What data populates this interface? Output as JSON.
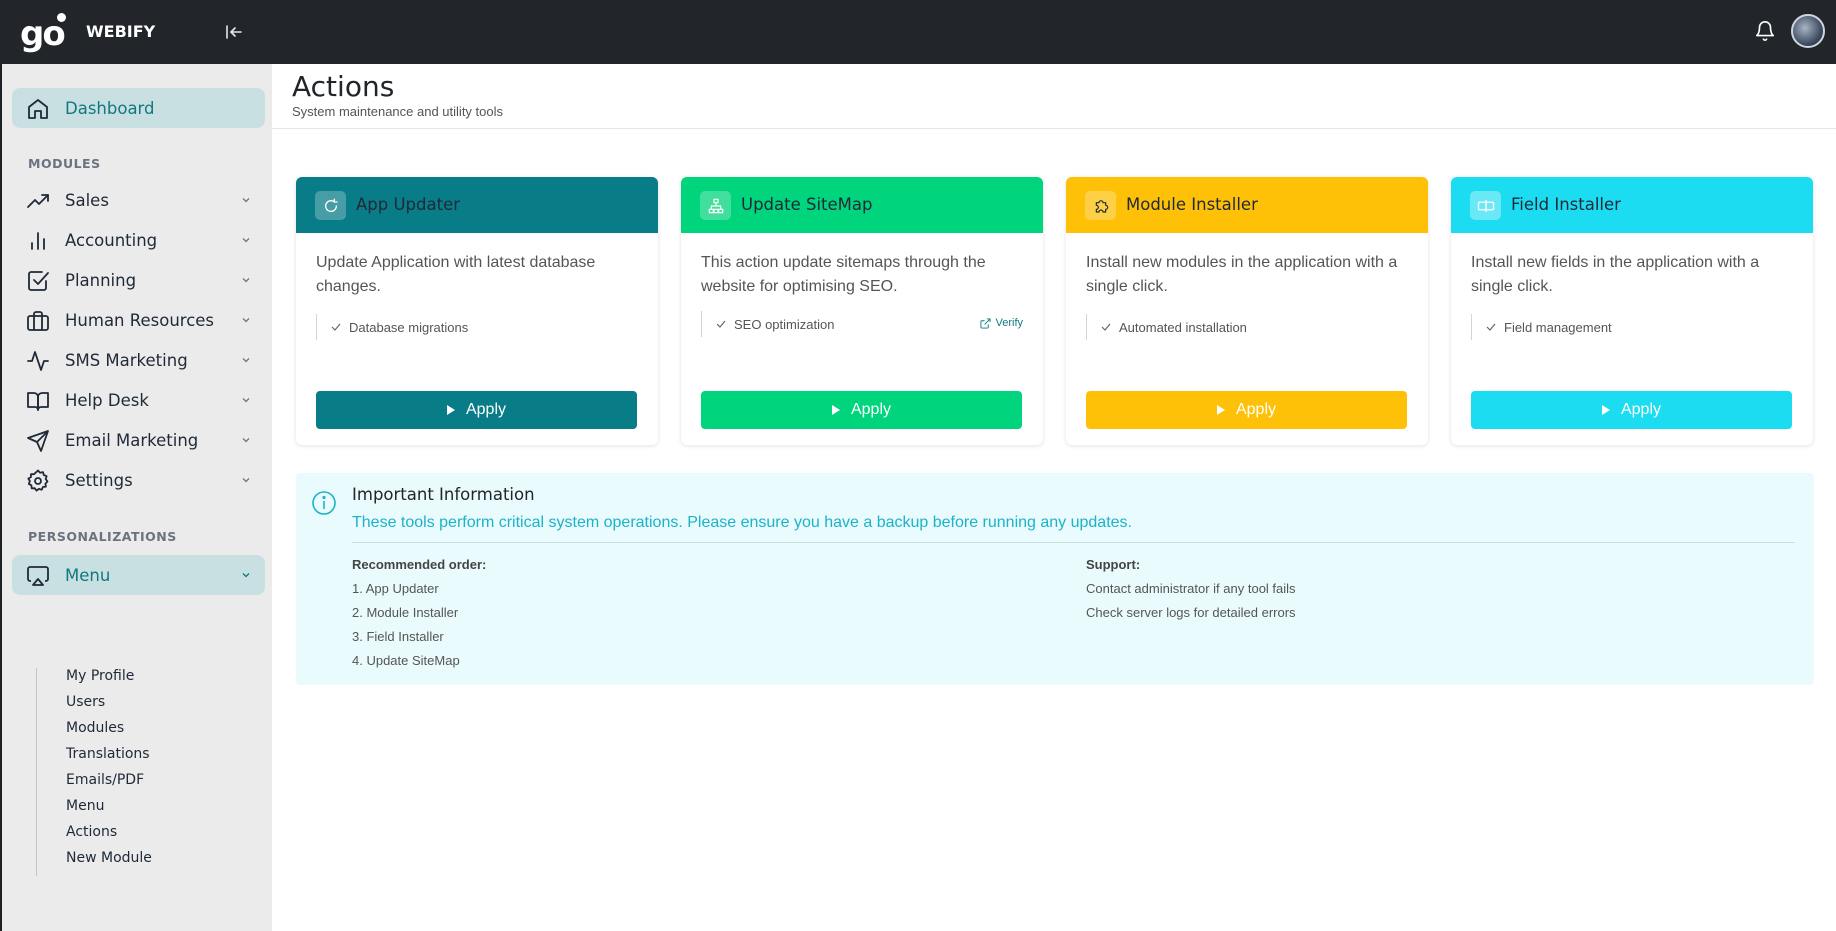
{
  "app": {
    "logo": "go",
    "brand": "WEBIFY"
  },
  "sidebar": {
    "dashboard": "Dashboard",
    "modules_title": "MODULES",
    "modules": [
      {
        "label": "Sales",
        "icon": "trending-up-icon"
      },
      {
        "label": "Accounting",
        "icon": "bar-chart-icon"
      },
      {
        "label": "Planning",
        "icon": "checkbox-icon"
      },
      {
        "label": "Human Resources",
        "icon": "briefcase-icon"
      },
      {
        "label": "SMS Marketing",
        "icon": "activity-icon"
      },
      {
        "label": "Help Desk",
        "icon": "book-icon"
      },
      {
        "label": "Email Marketing",
        "icon": "send-icon"
      },
      {
        "label": "Settings",
        "icon": "gear-icon"
      }
    ],
    "personalizations_title": "PERSONALIZATIONS",
    "menu_label": "Menu",
    "submenu": [
      "My Profile",
      "Users",
      "Modules",
      "Translations",
      "Emails/PDF",
      "Menu",
      "Actions",
      "New Module"
    ]
  },
  "page": {
    "title": "Actions",
    "subtitle": "System maintenance and utility tools"
  },
  "cards": [
    {
      "title": "App Updater",
      "icon": "refresh-icon",
      "description": "Update Application with latest database changes.",
      "feature": "Database migrations",
      "button": "Apply",
      "color": "#087c87",
      "text_color": "#ffffff"
    },
    {
      "title": "Update SiteMap",
      "icon": "sitemap-icon",
      "description": "This action update sitemaps through the website for optimising SEO.",
      "feature": "SEO optimization",
      "link": "Verify",
      "button": "Apply",
      "color": "#00d47d",
      "text_color": "#ffffff"
    },
    {
      "title": "Module Installer",
      "icon": "puzzle-icon",
      "description": "Install new modules in the application with a single click.",
      "feature": "Automated installation",
      "button": "Apply",
      "color": "#fec107",
      "text_color": "#ffffff"
    },
    {
      "title": "Field Installer",
      "icon": "input-field-icon",
      "description": "Install new fields in the application with a single click.",
      "feature": "Field management",
      "button": "Apply",
      "color": "#1bdcf0",
      "text_color": "#ffffff"
    }
  ],
  "info": {
    "title": "Important Information",
    "text": "These tools perform critical system operations. Please ensure you have a backup before running any updates.",
    "order_title": "Recommended order:",
    "order": [
      "1. App Updater",
      "2. Module Installer",
      "3. Field Installer",
      "4. Update SiteMap"
    ],
    "support_title": "Support:",
    "support": [
      "Contact administrator if any tool fails",
      "Check server logs for detailed errors"
    ]
  }
}
